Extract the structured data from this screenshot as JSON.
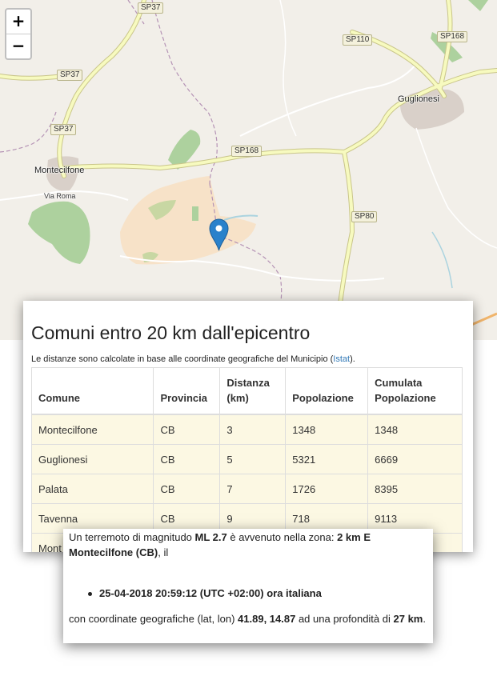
{
  "map": {
    "zoom_in_label": "+",
    "zoom_out_label": "−",
    "road_labels": [
      "SP37",
      "SP37",
      "SP37",
      "SP110",
      "SP168",
      "SP168",
      "SP80"
    ],
    "town_labels": [
      "Montecilfone",
      "Guglionesi"
    ],
    "street_labels": [
      "Via Roma"
    ]
  },
  "table_panel": {
    "title": "Comuni entro 20 km dall'epicentro",
    "note_text": "Le distanze sono calcolate in base alle coordinate geografiche del Municipio (",
    "note_link": "Istat",
    "note_end": ").",
    "headers": [
      "Comune",
      "Provincia",
      "Distanza (km)",
      "Popolazione",
      "Cumulata Popolazione"
    ],
    "rows": [
      [
        "Montecilfone",
        "CB",
        "3",
        "1348",
        "1348"
      ],
      [
        "Guglionesi",
        "CB",
        "5",
        "5321",
        "6669"
      ],
      [
        "Palata",
        "CB",
        "7",
        "1726",
        "8395"
      ],
      [
        "Tavenna",
        "CB",
        "9",
        "718",
        "9113"
      ],
      [
        "Mont",
        "",
        "",
        "",
        ""
      ]
    ]
  },
  "quake_card": {
    "line1_a": "Un terremoto di magnitudo ",
    "magnitude": "ML 2.7",
    "line1_b": " è avvenuto nella zona: ",
    "zone": "2 km E Montecilfone (CB)",
    "line1_c": ", il",
    "datetime": "25-04-2018 20:59:12 (UTC +02:00) ora italiana",
    "line2_a": "con coordinate geografiche (lat, lon) ",
    "lat": "41.89",
    "comma": ", ",
    "lon": "14.87",
    "line2_b": " ad una profondità di ",
    "depth": "27 km",
    "period": "."
  },
  "colors": {
    "map_bg": "#f2efe9",
    "road_yellow": "#f7fabf",
    "forest": "#add19e",
    "municipality_area": "#f7e2c8",
    "marker_blue": "#2a81cb",
    "table_row_bg": "#fcf8e3",
    "link": "#337ab7"
  }
}
